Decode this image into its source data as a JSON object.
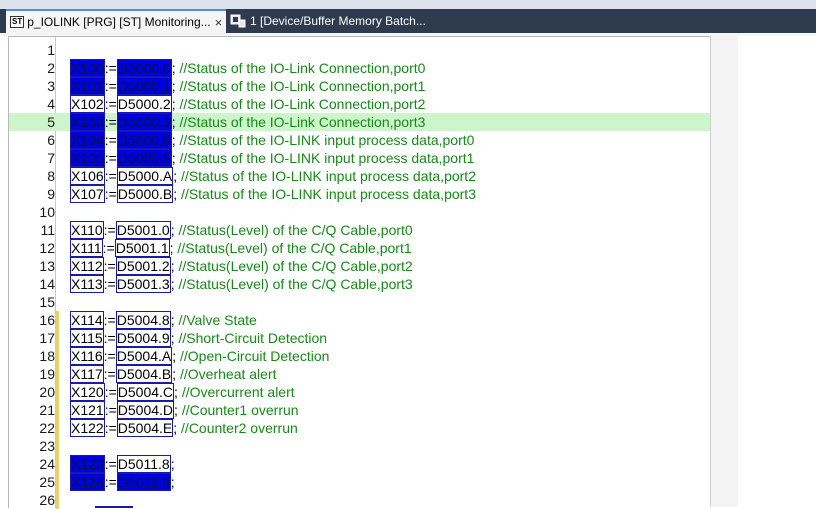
{
  "tabs": [
    {
      "badge": "ST",
      "title": "p_IOLINK [PRG] [ST] Monitoring...",
      "close": "×",
      "icon": "device-icon"
    },
    {
      "title": "1 [Device/Buffer Memory Batch...",
      "icon": "memory-batch-icon"
    }
  ],
  "editor": {
    "lines": [
      {
        "n": "1"
      },
      {
        "n": "2",
        "a": "X100",
        "op": ":=",
        "b": "D5000.0",
        "c": "; //Status of the IO-Link Connection,port0",
        "sa": true,
        "sb": true
      },
      {
        "n": "3",
        "a": "X101",
        "op": ":=",
        "b": "D5000.1",
        "c": "; //Status of the IO-Link Connection,port1",
        "sa": true,
        "sb": true
      },
      {
        "n": "4",
        "a": "X102",
        "op": ":=",
        "b": "D5000.2",
        "c": "; //Status of the IO-Link Connection,port2"
      },
      {
        "n": "5",
        "a": "X103",
        "op": ":=",
        "b": "D5000.3",
        "c": "; //Status of the IO-Link Connection,port3",
        "sa": true,
        "sb": true,
        "hl": true
      },
      {
        "n": "6",
        "a": "X104",
        "op": ":=",
        "b": "D5000.8",
        "c": "; //Status of the IO-LINK input process data,port0",
        "sa": true,
        "sb": true
      },
      {
        "n": "7",
        "a": "X105",
        "op": ":=",
        "b": "D5000.9",
        "c": "; //Status of the IO-LINK input process data,port1",
        "sa": true,
        "sb": true
      },
      {
        "n": "8",
        "a": "X106",
        "op": ":=",
        "b": "D5000.A",
        "c": "; //Status of the IO-LINK input process data,port2"
      },
      {
        "n": "9",
        "a": "X107",
        "op": ":=",
        "b": "D5000.B",
        "c": "; //Status of the IO-LINK input process data,port3"
      },
      {
        "n": "10"
      },
      {
        "n": "11",
        "a": "X110",
        "op": ":=",
        "b": "D5001.0",
        "c": "; //Status(Level) of the C/Q Cable,port0"
      },
      {
        "n": "12",
        "a": "X111",
        "op": ":=",
        "b": "D5001.1",
        "c": "; //Status(Level) of the C/Q Cable,port1"
      },
      {
        "n": "13",
        "a": "X112",
        "op": ":=",
        "b": "D5001.2",
        "c": "; //Status(Level) of the C/Q Cable,port2"
      },
      {
        "n": "14",
        "a": "X113",
        "op": ":=",
        "b": "D5001.3",
        "c": "; //Status(Level) of the C/Q Cable,port3"
      },
      {
        "n": "15"
      },
      {
        "n": "16",
        "a": "X114",
        "op": ":=",
        "b": "D5004.8",
        "c": "; //Valve State",
        "mk": true
      },
      {
        "n": "17",
        "a": "X115",
        "op": ":=",
        "b": "D5004.9",
        "c": "; //Short-Circuit Detection",
        "mk": true
      },
      {
        "n": "18",
        "a": "X116",
        "op": ":=",
        "b": "D5004.A",
        "c": "; //Open-Circuit Detection",
        "mk": true
      },
      {
        "n": "19",
        "a": "X117",
        "op": ":=",
        "b": "D5004.B",
        "c": "; //Overheat alert",
        "mk": true
      },
      {
        "n": "20",
        "a": "X120",
        "op": ":=",
        "b": "D5004.C",
        "c": "; //Overcurrent alert",
        "mk": true
      },
      {
        "n": "21",
        "a": "X121",
        "op": ":=",
        "b": "D5004.D",
        "c": "; //Counter1 overrun",
        "mk": true
      },
      {
        "n": "22",
        "a": "X122",
        "op": ":=",
        "b": "D5004.E",
        "c": "; //Counter2 overrun",
        "mk": true
      },
      {
        "n": "23",
        "mk": true
      },
      {
        "n": "24",
        "a": "X123",
        "op": ":=",
        "b": "D5011.8",
        "c": ";",
        "sa": true,
        "mk": true
      },
      {
        "n": "25",
        "a": "X124",
        "op": ":=",
        "b": "D5011.9",
        "c": ";",
        "sa": true,
        "sb": true,
        "mk": true
      },
      {
        "n": "26",
        "mk": true
      }
    ]
  }
}
